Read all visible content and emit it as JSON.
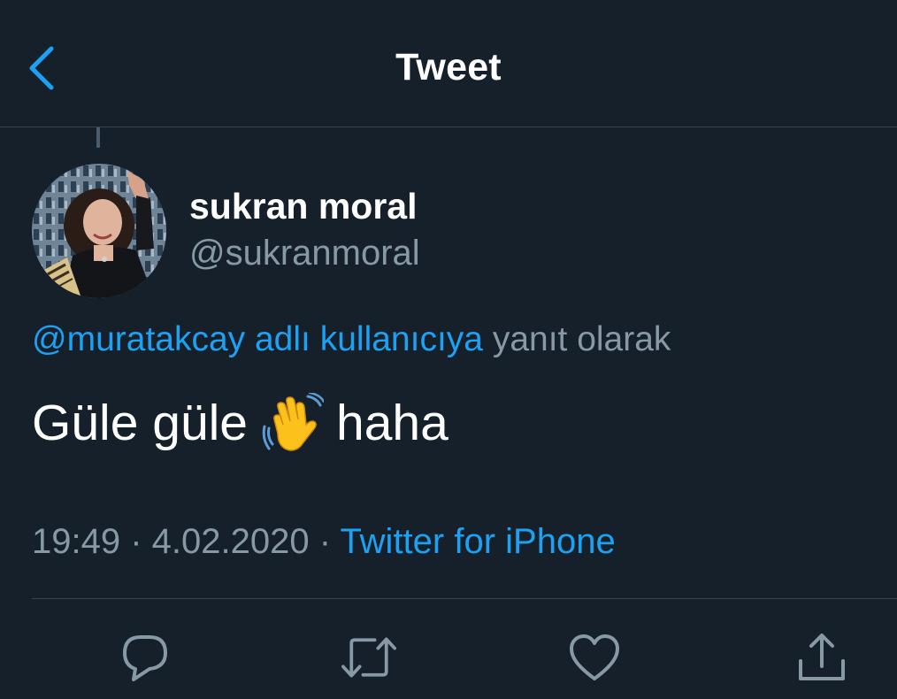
{
  "header": {
    "title": "Tweet",
    "back_icon": "chevron-left-icon"
  },
  "tweet": {
    "display_name": "sukran moral",
    "handle": "@sukranmoral",
    "reply_to_link": "@muratakcay adlı kullanıcıya",
    "reply_to_suffix": " yanıt olarak",
    "text_before_emoji": "Güle güle",
    "emoji": "waving-hand-icon",
    "text_after_emoji": "haha",
    "time": "19:49",
    "separator": " · ",
    "date": "4.02.2020",
    "source": "Twitter for iPhone"
  },
  "actions": [
    {
      "name": "reply-icon"
    },
    {
      "name": "retweet-icon"
    },
    {
      "name": "like-icon"
    },
    {
      "name": "share-icon"
    }
  ],
  "colors": {
    "background": "#15202b",
    "accent": "#1da1f2",
    "secondary_text": "#8899a6",
    "divider": "#38444d"
  }
}
